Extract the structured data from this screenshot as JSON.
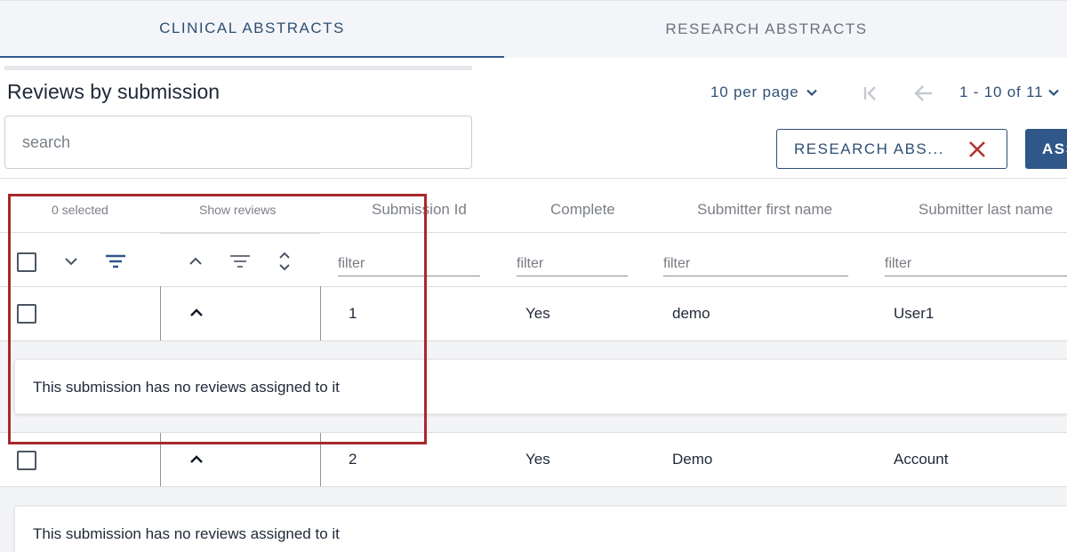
{
  "tabs": [
    {
      "label": "CLINICAL ABSTRACTS",
      "active": true
    },
    {
      "label": "RESEARCH ABSTRACTS",
      "active": false
    }
  ],
  "page_title": "Reviews by submission",
  "pagination": {
    "per_page": "10 per page",
    "range": "1 - 10 of 11"
  },
  "search": {
    "placeholder": "search",
    "value": ""
  },
  "filter_chip": {
    "label": "RESEARCH ABS..."
  },
  "assign_button": {
    "label": "ASSIGN"
  },
  "table": {
    "selected_count": "0 selected",
    "show_reviews": "Show reviews",
    "columns": [
      "Submission Id",
      "Complete",
      "Submitter first name",
      "Submitter last name"
    ],
    "filter_placeholder": "filter",
    "rows": [
      {
        "id": "1",
        "complete": "Yes",
        "first": "demo",
        "last": "User1",
        "note": "This submission has no reviews assigned to it"
      },
      {
        "id": "2",
        "complete": "Yes",
        "first": "Demo",
        "last": "Account",
        "note": "This submission has no reviews assigned to it"
      }
    ]
  },
  "colors": {
    "accent": "#2f5788",
    "highlight": "#a8282c",
    "close_x": "#b3332f"
  }
}
